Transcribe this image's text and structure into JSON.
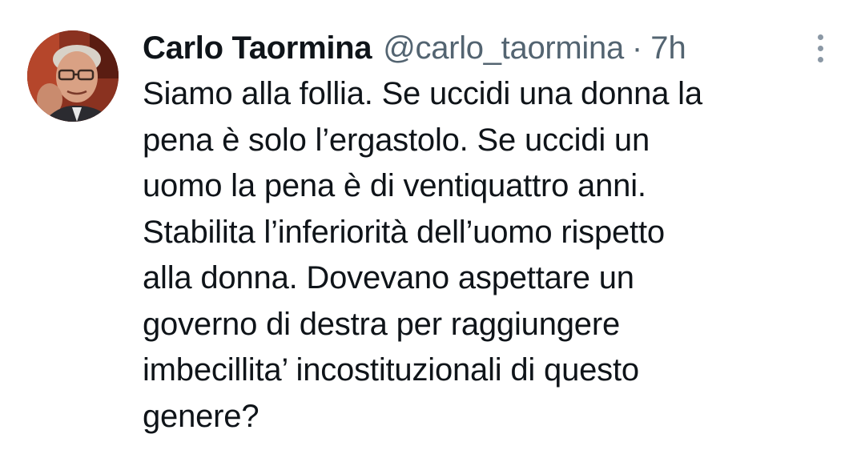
{
  "author": {
    "name": "Carlo Taormina",
    "handle": "@carlo_taormina",
    "separator": "·",
    "time": "7h"
  },
  "tweet": {
    "lines": [
      "Siamo alla follia. Se uccidi una donna la",
      "pena è solo l’ergastolo. Se uccidi un",
      "uomo la pena è di ventiquattro anni.",
      "Stabilita l’inferiorità dell’uomo rispetto",
      "alla donna. Dovevano aspettare un",
      "governo di destra per raggiungere",
      "imbecillita’ incostituzionali di questo",
      "genere?"
    ]
  },
  "icons": {
    "avatar": "profile-photo",
    "more": "more-vertical-icon"
  },
  "colors": {
    "text": "#0f1419",
    "secondary": "#536471",
    "background": "#ffffff"
  }
}
